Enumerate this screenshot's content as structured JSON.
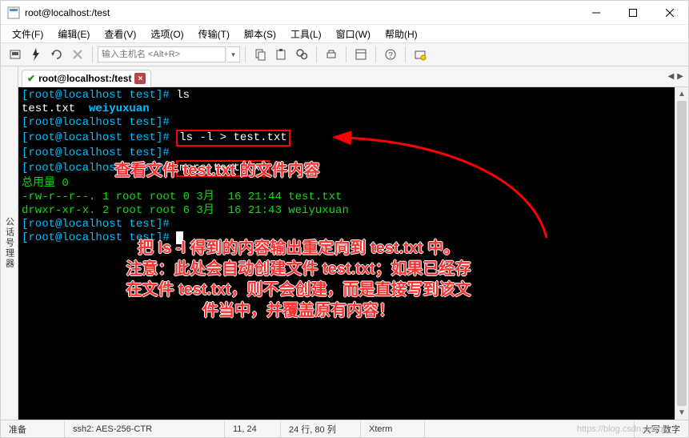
{
  "titlebar": {
    "title": "root@localhost:/test"
  },
  "menubar": {
    "items": [
      "文件(F)",
      "编辑(E)",
      "查看(V)",
      "选项(O)",
      "传输(T)",
      "脚本(S)",
      "工具(L)",
      "窗口(W)",
      "帮助(H)"
    ]
  },
  "toolbar": {
    "host_placeholder": "输入主机名 <Alt+R>"
  },
  "sidebar": {
    "label": "公话号理器"
  },
  "tab": {
    "title": "root@localhost:/test"
  },
  "terminal": {
    "lines": [
      {
        "prompt": "[root@localhost test]#",
        "cmd": " ls"
      },
      {
        "text": "test.txt  ",
        "cls": "f",
        "tail": "weiyuxuan",
        "tailcls": "d"
      },
      {
        "prompt": "[root@localhost test]#",
        "cmd": ""
      },
      {
        "prompt": "[root@localhost test]#",
        "cmd": " ",
        "boxed": "ls -l > test.txt"
      },
      {
        "prompt": "[root@localhost test]#",
        "cmd": ""
      },
      {
        "prompt": "[root@localhost test]#",
        "cmd": " ",
        "boxed": "more test.txt"
      },
      {
        "raw": "总用量 0",
        "cls": "g"
      },
      {
        "raw": "-rw-r--r--. 1 root root 0 3月  16 21:44 test.txt",
        "cls": "g"
      },
      {
        "raw": "drwxr-xr-x. 2 root root 6 3月  16 21:43 weiyuxuan",
        "cls": "g"
      },
      {
        "prompt": "[root@localhost test]#",
        "cmd": ""
      },
      {
        "prompt": "[root@localhost test]#",
        "cmd": " ",
        "cursor": true
      }
    ]
  },
  "annotations": {
    "a1": "查看文件 test.txt 的文件内容",
    "a2": "把 ls -l 得到的内容输出重定向到 test.txt 中。\n注意：此处会自动创建文件 test.txt；如果已经存\n在文件 test.txt，则不会创建，而是直接写到该文\n件当中，并覆盖原有内容！"
  },
  "statusbar": {
    "ready": "准备",
    "cipher": "ssh2: AES-256-CTR",
    "pos": "11, 24",
    "size": "24 行, 80 列",
    "term": "Xterm",
    "caps": "大写 数字"
  },
  "watermark": "https://blog.csdn.net/qq_..."
}
